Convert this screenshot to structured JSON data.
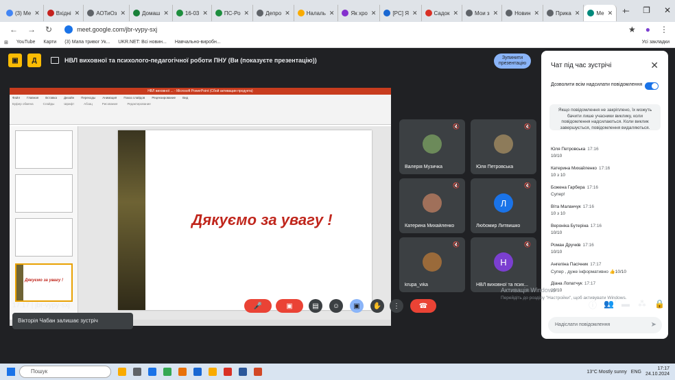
{
  "tabs": [
    {
      "label": "(3) Ме",
      "color": "#4285f4"
    },
    {
      "label": "Вхідні",
      "color": "#c5221f"
    },
    {
      "label": "АОТиОз",
      "color": "#5f6368"
    },
    {
      "label": "Домаш",
      "color": "#188038"
    },
    {
      "label": "16-03",
      "color": "#1e8e3e"
    },
    {
      "label": "ПС-Ро",
      "color": "#1e8e3e"
    },
    {
      "label": "Депро",
      "color": "#5f6368"
    },
    {
      "label": "Налаль",
      "color": "#f9ab00"
    },
    {
      "label": "Як хро",
      "color": "#8430ce"
    },
    {
      "label": "[PC] Я",
      "color": "#1967d2"
    },
    {
      "label": "Садок",
      "color": "#d93025"
    },
    {
      "label": "Мои з",
      "color": "#5f6368"
    },
    {
      "label": "Новин",
      "color": "#5f6368"
    },
    {
      "label": "Прика",
      "color": "#5f6368"
    },
    {
      "label": "Ме",
      "color": "#00897b"
    }
  ],
  "browser": {
    "url": "meet.google.com/jbr-vypy-sxj",
    "bookmarks": [
      "YouTube",
      "Карти",
      "(3) Мапа тривог Ук...",
      "UKR.NET: Всі новин...",
      "Навчально-виробн..."
    ],
    "all_bookmarks": "Усі закладки"
  },
  "meet": {
    "presenting_title": "НВЛ виховної та психолого-педагогічної роботи ПНУ (Ви (показуєте презентацію))",
    "stop_button": "Зупинити презентацію",
    "slide_text": "Дякуємо за увагу !",
    "ppt_window_title": "НВЛ виховної ... - Microsoft PowerPoint (Сбой активации продукта)",
    "participants": [
      {
        "name": "Валерія Музичка",
        "initial": "",
        "color": "#6c8a5a"
      },
      {
        "name": "Юля Петровська",
        "initial": "",
        "color": "#8d7b5a"
      },
      {
        "name": "Катерина Михайленко",
        "initial": "",
        "color": "#a0705a"
      },
      {
        "name": "Любомир Литвишко",
        "initial": "Л",
        "color": "#1a73e8"
      },
      {
        "name": "krupa_vika",
        "initial": "",
        "color": "#9a6a3a"
      },
      {
        "name": "НВЛ виховної та псих...",
        "initial": "Н",
        "color": "#7b3fd0"
      }
    ],
    "toast": "Вікторія Чабан залишає зустріч",
    "time": "17:17",
    "code": "jbr-vypy-sxj",
    "participants_count": "7"
  },
  "chat": {
    "title": "Чат під час зустрічі",
    "permission": "Дозволити всім надсилати повідомлення",
    "info": "Якщо повідомлення не закріплено, їх можуть бачити лише учасники виклику, коли повідомлення надсилаються. Коли виклик завершується, повідомлення видаляються.",
    "messages": [
      {
        "author": "Юля Петровська",
        "time": "17:16",
        "text": "10/10"
      },
      {
        "author": "Катерина Михайленко",
        "time": "17:16",
        "text": "10 з 10"
      },
      {
        "author": "Божена Гарбера",
        "time": "17:16",
        "text": "Супер!"
      },
      {
        "author": "Віта Маланчук",
        "time": "17:16",
        "text": "10 з 10"
      },
      {
        "author": "Вероніка Бутеріна",
        "time": "17:16",
        "text": "10/10"
      },
      {
        "author": "Роман Дручків",
        "time": "17:16",
        "text": "10/10"
      },
      {
        "author": "Ангеліна Пасічник",
        "time": "17:17",
        "text": "Супер , дуже інформативно 👍10/10"
      },
      {
        "author": "Діана Лопатчук",
        "time": "17:17",
        "text": "10/10"
      }
    ],
    "input_placeholder": "Надіслати повідомлення"
  },
  "watermark": {
    "line1": "Активація Windows",
    "line2": "Перейдіть до розділу \"Настройки\", щоб активувати Windows."
  },
  "taskbar": {
    "search": "Пошук",
    "weather": "13°C  Mostly sunny",
    "lang": "ENG",
    "time": "17:17",
    "date": "24.10.2024"
  }
}
